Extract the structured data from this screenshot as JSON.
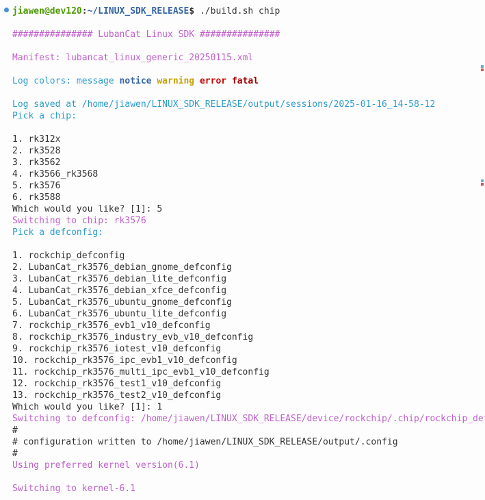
{
  "prompt": {
    "user": "jiawen",
    "host": "dev120",
    "path": "~/LINUX_SDK_RELEASE",
    "command": "./build.sh chip"
  },
  "banner": {
    "left": "###############",
    "title": "LubanCat Linux SDK",
    "right": "###############"
  },
  "manifest": {
    "label": "Manifest:",
    "file": "lubancat_linux_generic_20250115.xml"
  },
  "colors": {
    "label": "Log colors:",
    "message": "message",
    "notice": "notice",
    "warning": "warning",
    "error": "error",
    "fatal": "fatal"
  },
  "log_saved": {
    "label": "Log saved at",
    "path": "/home/jiawen/LINUX_SDK_RELEASE/output/sessions/2025-01-16_14-58-12"
  },
  "chip": {
    "pick": "Pick a chip:",
    "items": [
      "1. rk312x",
      "2. rk3528",
      "3. rk3562",
      "4. rk3566_rk3568",
      "5. rk3576",
      "6. rk3588"
    ],
    "prompt": "Which would you like? [1]: 5",
    "switch_label": "Switching to chip:",
    "switch_val": "rk3576"
  },
  "defconfig": {
    "pick": "Pick a defconfig:",
    "items": [
      "1. rockchip_defconfig",
      "2. LubanCat_rk3576_debian_gnome_defconfig",
      "3. LubanCat_rk3576_debian_lite_defconfig",
      "4. LubanCat_rk3576_debian_xfce_defconfig",
      "5. LubanCat_rk3576_ubuntu_gnome_defconfig",
      "6. LubanCat_rk3576_ubuntu_lite_defconfig",
      "7. rockchip_rk3576_evb1_v10_defconfig",
      "8. rockchip_rk3576_industry_evb_v10_defconfig",
      "9. rockchip_rk3576_iotest_v10_defconfig",
      "10. rockchip_rk3576_ipc_evb1_v10_defconfig",
      "11. rockchip_rk3576_multi_ipc_evb1_v10_defconfig",
      "12. rockchip_rk3576_test1_v10_defconfig",
      "13. rockchip_rk3576_test2_v10_defconfig"
    ],
    "prompt": "Which would you like? [1]: 1",
    "switch_label": "Switching to defconfig:",
    "switch_val": "/home/jiawen/LINUX_SDK_RELEASE/device/rockchip/.chip/rockchip_defconfig"
  },
  "config": {
    "hash1": "#",
    "written": "# configuration written to /home/jiawen/LINUX_SDK_RELEASE/output/.config",
    "hash2": "#"
  },
  "kernel": {
    "preferred": "Using preferred kernel version(6.1)",
    "switch": "Switching to kernel-6.1"
  }
}
